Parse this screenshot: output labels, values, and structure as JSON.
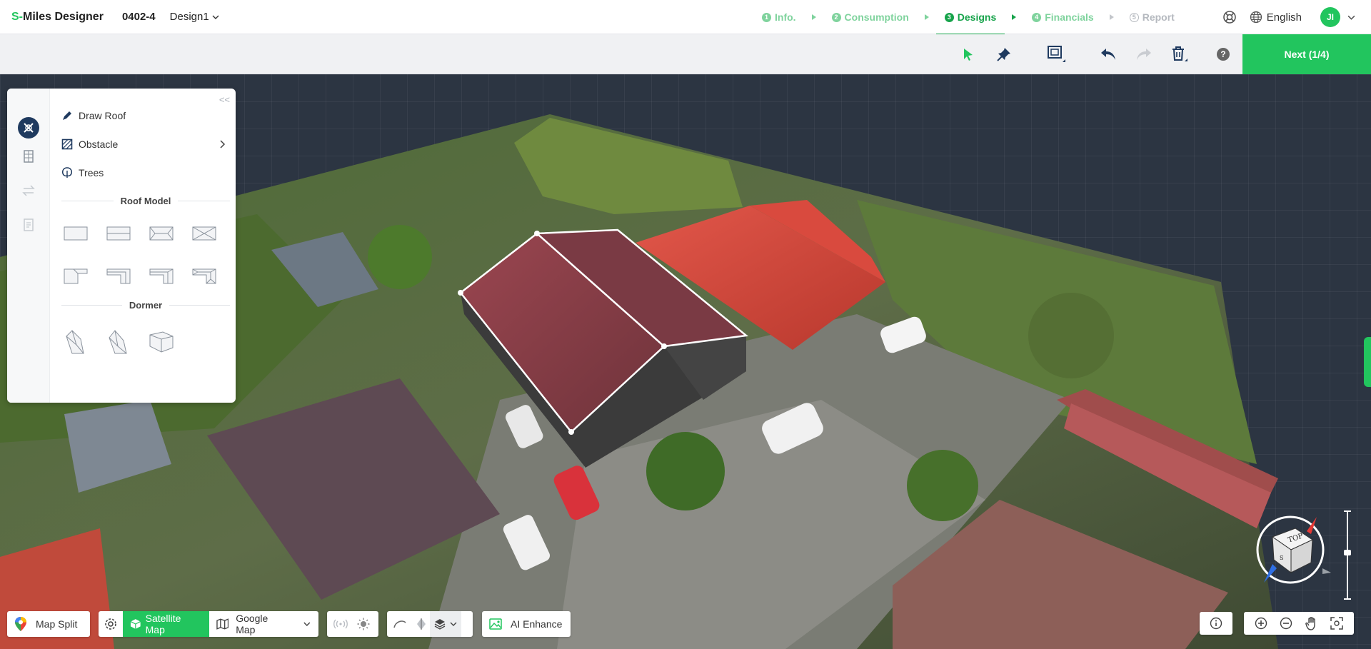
{
  "header": {
    "brand_s": "S-",
    "brand_rest": "Miles Designer",
    "project_code": "0402-4",
    "design_name": "Design1",
    "steps": [
      {
        "num": "1",
        "label": "Info."
      },
      {
        "num": "2",
        "label": "Consumption"
      },
      {
        "num": "3",
        "label": "Designs"
      },
      {
        "num": "4",
        "label": "Financials"
      },
      {
        "num": "5",
        "label": "Report"
      }
    ],
    "language": "English",
    "avatar_initials": "JI"
  },
  "toolbar": {
    "next_label": "Next (1/4)",
    "help_label": "?"
  },
  "panel": {
    "items": [
      {
        "label": "Draw Roof"
      },
      {
        "label": "Obstacle"
      },
      {
        "label": "Trees"
      }
    ],
    "roof_model_title": "Roof Model",
    "dormer_title": "Dormer",
    "collapse_label": "<<"
  },
  "bottom": {
    "map_split": "Map Split",
    "satellite": "Satellite Map",
    "google": "Google Map",
    "ai_enhance": "AI Enhance"
  },
  "compass": {
    "top_label": "TOP",
    "south_label": "S"
  },
  "colors": {
    "accent": "#22c55e",
    "accent_dark": "#16a34a",
    "navy": "#1f3a5f"
  }
}
